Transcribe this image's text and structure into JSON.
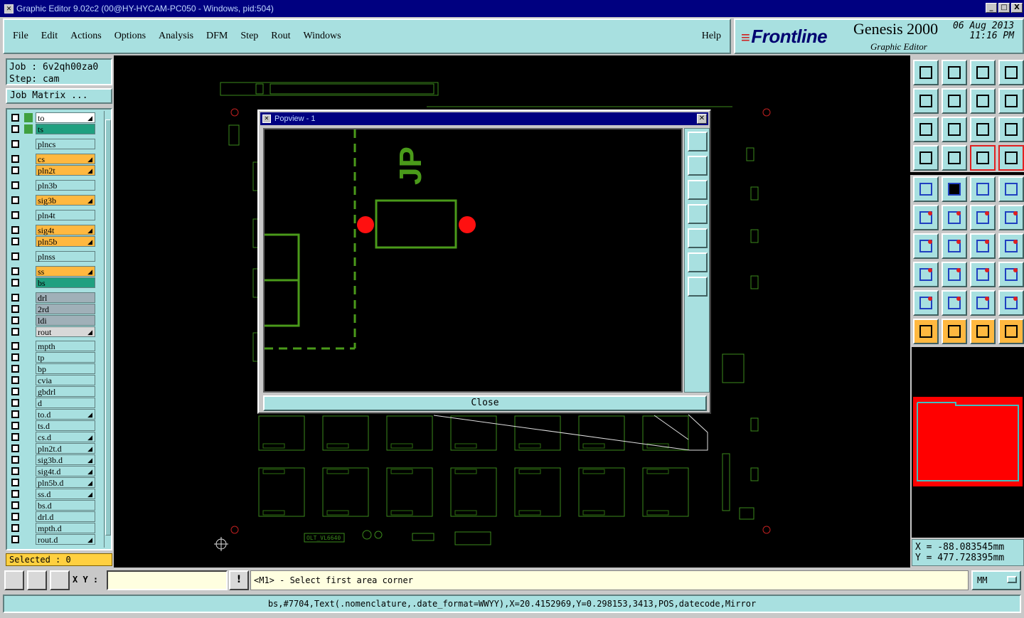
{
  "window": {
    "title": "Graphic Editor 9.02c2 (00@HY-HYCAM-PC050 - Windows, pid:504)",
    "buttons": [
      "_",
      "□",
      "X"
    ]
  },
  "menu": {
    "items": [
      "File",
      "Edit",
      "Actions",
      "Options",
      "Analysis",
      "DFM",
      "Step",
      "Rout",
      "Windows"
    ],
    "help": "Help"
  },
  "brand": {
    "logo": "Frontline",
    "product": "Genesis 2000",
    "subtitle": "Graphic Editor",
    "date": "06 Aug 2013",
    "time": "11:16 PM"
  },
  "job": {
    "job_line": "Job : 6v2qh00za0",
    "step_line": "Step: cam",
    "matrix_button": "Job Matrix ..."
  },
  "layers": [
    {
      "name": "to",
      "color": "#ffffff",
      "swatch": "#40a040",
      "arrow": true
    },
    {
      "name": "ts",
      "color": "#20a080",
      "swatch": "#40a040",
      "arrow": false
    },
    {
      "name": "plncs",
      "color": "#a8e0e0",
      "swatch": "",
      "arrow": false
    },
    {
      "name": "cs",
      "color": "#ffb840",
      "swatch": "",
      "arrow": true
    },
    {
      "name": "pln2t",
      "color": "#ffb840",
      "swatch": "",
      "arrow": true
    },
    {
      "name": "pln3b",
      "color": "#a8e0e0",
      "swatch": "",
      "arrow": false
    },
    {
      "name": "sig3b",
      "color": "#ffb840",
      "swatch": "",
      "arrow": true
    },
    {
      "name": "pln4t",
      "color": "#a8e0e0",
      "swatch": "",
      "arrow": false
    },
    {
      "name": "sig4t",
      "color": "#ffb840",
      "swatch": "",
      "arrow": true
    },
    {
      "name": "pln5b",
      "color": "#ffb840",
      "swatch": "",
      "arrow": true
    },
    {
      "name": "plnss",
      "color": "#a8e0e0",
      "swatch": "",
      "arrow": false
    },
    {
      "name": "ss",
      "color": "#ffb840",
      "swatch": "",
      "arrow": true
    },
    {
      "name": "bs",
      "color": "#20a080",
      "swatch": "",
      "arrow": false
    },
    {
      "name": "drl",
      "color": "#a0b0b8",
      "swatch": "",
      "arrow": false
    },
    {
      "name": "2rd",
      "color": "#a0b0b8",
      "swatch": "",
      "arrow": false
    },
    {
      "name": "ldi",
      "color": "#a0b0b8",
      "swatch": "",
      "arrow": false
    },
    {
      "name": "rout",
      "color": "#d8d8d8",
      "swatch": "",
      "arrow": true
    },
    {
      "name": "mpth",
      "color": "#a8e0e0",
      "swatch": "",
      "arrow": false
    },
    {
      "name": "tp",
      "color": "#a8e0e0",
      "swatch": "",
      "arrow": false
    },
    {
      "name": "bp",
      "color": "#a8e0e0",
      "swatch": "",
      "arrow": false
    },
    {
      "name": "cvia",
      "color": "#a8e0e0",
      "swatch": "",
      "arrow": false
    },
    {
      "name": "gbdrl",
      "color": "#a8e0e0",
      "swatch": "",
      "arrow": false
    },
    {
      "name": "d",
      "color": "#a8e0e0",
      "swatch": "",
      "arrow": false
    },
    {
      "name": "to.d",
      "color": "#a8e0e0",
      "swatch": "",
      "arrow": true
    },
    {
      "name": "ts.d",
      "color": "#a8e0e0",
      "swatch": "",
      "arrow": false
    },
    {
      "name": "cs.d",
      "color": "#a8e0e0",
      "swatch": "",
      "arrow": true
    },
    {
      "name": "pln2t.d",
      "color": "#a8e0e0",
      "swatch": "",
      "arrow": true
    },
    {
      "name": "sig3b.d",
      "color": "#a8e0e0",
      "swatch": "",
      "arrow": true
    },
    {
      "name": "sig4t.d",
      "color": "#a8e0e0",
      "swatch": "",
      "arrow": true
    },
    {
      "name": "pln5b.d",
      "color": "#a8e0e0",
      "swatch": "",
      "arrow": true
    },
    {
      "name": "ss.d",
      "color": "#a8e0e0",
      "swatch": "",
      "arrow": true
    },
    {
      "name": "bs.d",
      "color": "#a8e0e0",
      "swatch": "",
      "arrow": false
    },
    {
      "name": "drl.d",
      "color": "#a8e0e0",
      "swatch": "",
      "arrow": false
    },
    {
      "name": "mpth.d",
      "color": "#a8e0e0",
      "swatch": "",
      "arrow": false
    },
    {
      "name": "rout.d",
      "color": "#a8e0e0",
      "swatch": "",
      "arrow": true
    }
  ],
  "selected": "Selected : 0",
  "popview": {
    "title": "Popview - 1",
    "close_label": "Close",
    "silk_text": "JP"
  },
  "coords": {
    "x": "X = -88.083545mm",
    "y": "Y = 477.728395mm"
  },
  "bottom": {
    "xy_label": "X Y :",
    "xy_value": "",
    "exclaim": "!",
    "message": "<M1> - Select first area corner",
    "units": "MM"
  },
  "status": "bs,#7704,Text(.nomenclature,.date_format=WWYY),X=20.4152969,Y=0.298153,3413,POS,datecode,Mirror",
  "board_labels": {
    "bottom_text": "OLT_VL6640"
  }
}
